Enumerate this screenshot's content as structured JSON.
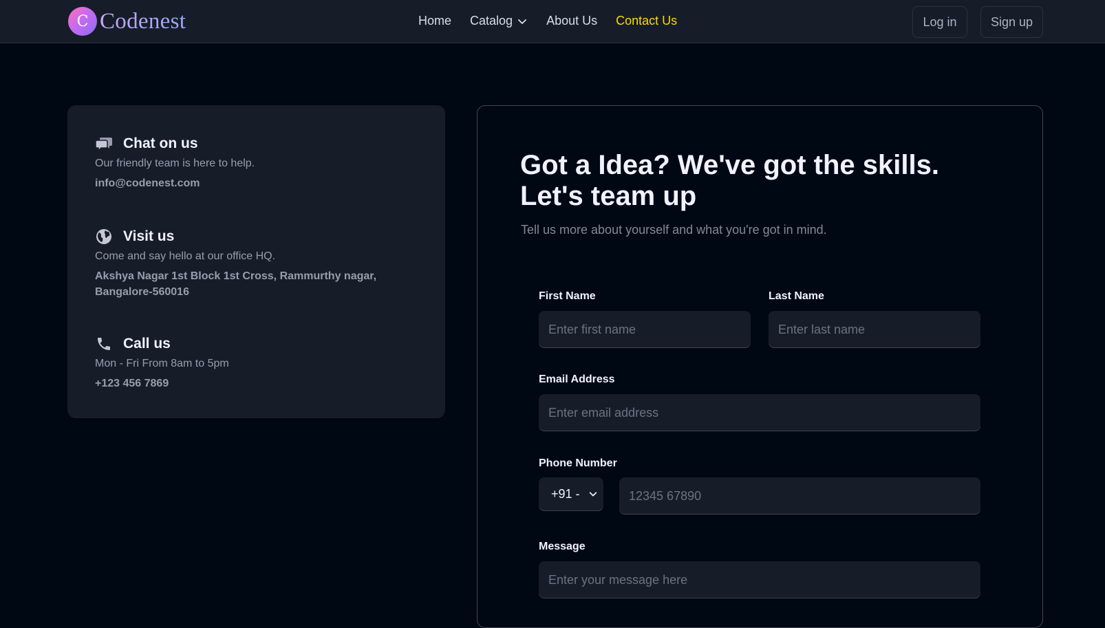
{
  "brand": {
    "logo_letter": "C",
    "name": "Codenest"
  },
  "nav": {
    "links": [
      "Home",
      "Catalog",
      "About Us",
      "Contact Us"
    ],
    "active": "Contact Us"
  },
  "auth": {
    "login": "Log in",
    "signup": "Sign up"
  },
  "contact_info": [
    {
      "icon": "chat-bubbles-icon",
      "title": "Chat on us",
      "desc": "Our friendly team is here to help.",
      "detail": "info@codenest.com"
    },
    {
      "icon": "globe-icon",
      "title": "Visit us",
      "desc": "Come and say hello at our office HQ.",
      "detail": "Akshya Nagar 1st Block 1st Cross, Rammurthy nagar, Bangalore-560016"
    },
    {
      "icon": "phone-icon",
      "title": "Call us",
      "desc": "Mon - Fri From 8am to 5pm",
      "detail": "+123 456 7869"
    }
  ],
  "form": {
    "heading": "Got a Idea? We've got the skills. Let's team up",
    "subheading": "Tell us more about yourself and what you're got in mind.",
    "first_name": {
      "label": "First Name",
      "placeholder": "Enter first name"
    },
    "last_name": {
      "label": "Last Name",
      "placeholder": "Enter last name"
    },
    "email": {
      "label": "Email Address",
      "placeholder": "Enter email address"
    },
    "phone": {
      "label": "Phone Number",
      "country_code": "+91 -",
      "placeholder": "12345 67890"
    },
    "message": {
      "label": "Message",
      "placeholder": "Enter your message here"
    }
  },
  "colors": {
    "bg": "#000814",
    "surface": "#161d29",
    "accent": "#ffd60a",
    "text": "#f1f2ff",
    "muted": "#999daa"
  }
}
